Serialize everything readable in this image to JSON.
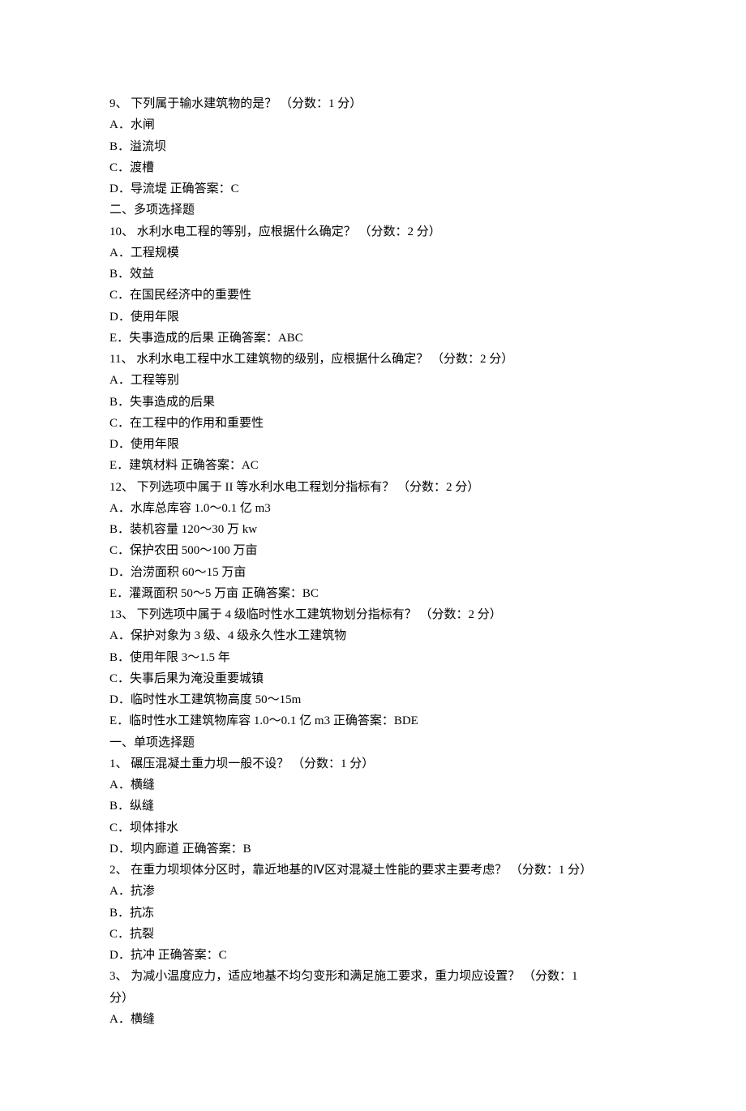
{
  "lines": [
    "9、  下列属于输水建筑物的是？  （分数：1 分）",
    "A．水闸",
    "B．溢流坝",
    "C．渡槽",
    "D．导流堤   正确答案：C",
    "二、多项选择题",
    "10、  水利水电工程的等别，应根据什么确定？  （分数：2 分）",
    "A．工程规模",
    "B．效益",
    "C．在国民经济中的重要性",
    "D．使用年限",
    "E．失事造成的后果   正确答案：ABC",
    "11、  水利水电工程中水工建筑物的级别，应根据什么确定？  （分数：2 分）",
    "A．工程等别",
    "B．失事造成的后果",
    "C．在工程中的作用和重要性",
    "D．使用年限",
    "E．建筑材料   正确答案：AC",
    "12、  下列选项中属于 II 等水利水电工程划分指标有？  （分数：2 分）",
    "A．水库总库容 1.0～0.1 亿 m3",
    "B．装机容量 120～30 万 kw",
    "C．保护农田 500～100 万亩",
    "D．治涝面积 60～15 万亩",
    "E．灌溉面积 50～5 万亩   正确答案：BC",
    "13、  下列选项中属于 4 级临时性水工建筑物划分指标有？  （分数：2 分）",
    "A．保护对象为 3 级、4 级永久性水工建筑物",
    "B．使用年限 3～1.5 年",
    "C．失事后果为淹没重要城镇",
    "D．临时性水工建筑物高度 50～15m",
    "E．临时性水工建筑物库容 1.0～0.1 亿 m3   正确答案：BDE",
    "一、单项选择题",
    "1、  碾压混凝土重力坝一般不设？  （分数：1 分）",
    "A．横缝",
    "B．纵缝",
    "C．坝体排水",
    "D．坝内廊道   正确答案：B",
    "2、  在重力坝坝体分区时，靠近地基的Ⅳ区对混凝土性能的要求主要考虑？  （分数：1 分）",
    "A．抗渗",
    "B．抗冻",
    "C．抗裂",
    "D．抗冲   正确答案：C",
    "3、  为减小温度应力，适应地基不均匀变形和满足施工要求，重力坝应设置？  （分数：1",
    "分）",
    "A．横缝"
  ]
}
